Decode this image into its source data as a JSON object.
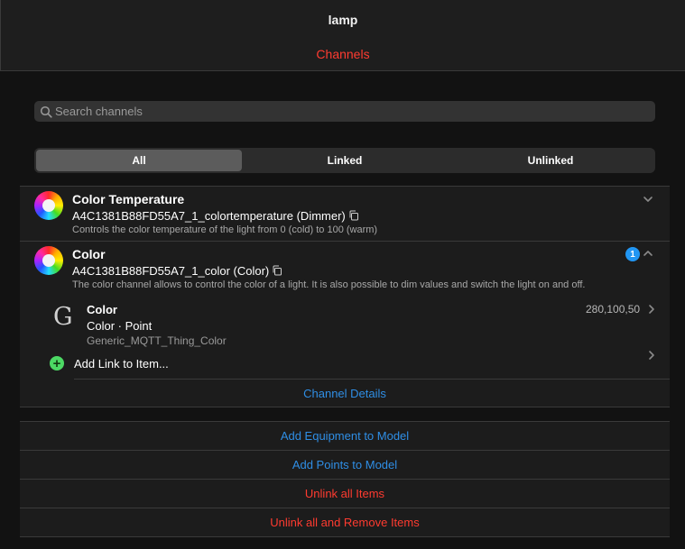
{
  "header": {
    "title": "lamp",
    "subtitle": "Channels"
  },
  "search": {
    "placeholder": "Search channels",
    "value": ""
  },
  "filter": {
    "segments": [
      {
        "label": "All",
        "active": true
      },
      {
        "label": "Linked",
        "active": false
      },
      {
        "label": "Unlinked",
        "active": false
      }
    ]
  },
  "channels": [
    {
      "title": "Color Temperature",
      "uid": "A4C1381B88FD55A7_1_colortemperature (Dimmer)",
      "description": "Controls the color temperature of the light from 0 (cold) to 100 (warm)",
      "expanded": false
    },
    {
      "title": "Color",
      "uid": "A4C1381B88FD55A7_1_color (Color)",
      "description": "The color channel allows to control the color of a light. It is also possible to dim values and switch the light on and off.",
      "expanded": true,
      "link_count": "1",
      "linked_item": {
        "icon_letter": "G",
        "name": "Color",
        "type": "Color · Point",
        "id": "Generic_MQTT_Thing_Color",
        "state": "280,100,50"
      },
      "add_link_label": "Add Link to Item...",
      "details_label": "Channel Details"
    }
  ],
  "actions": [
    {
      "label": "Add Equipment to Model",
      "tone": "blue"
    },
    {
      "label": "Add Points to Model",
      "tone": "blue"
    },
    {
      "label": "Unlink all Items",
      "tone": "red"
    },
    {
      "label": "Unlink all and Remove Items",
      "tone": "red"
    }
  ],
  "colors": {
    "accent_blue": "#2f8ee5",
    "danger_red": "#ff3b30",
    "success_green": "#4cd964",
    "badge_blue": "#2196f3"
  }
}
